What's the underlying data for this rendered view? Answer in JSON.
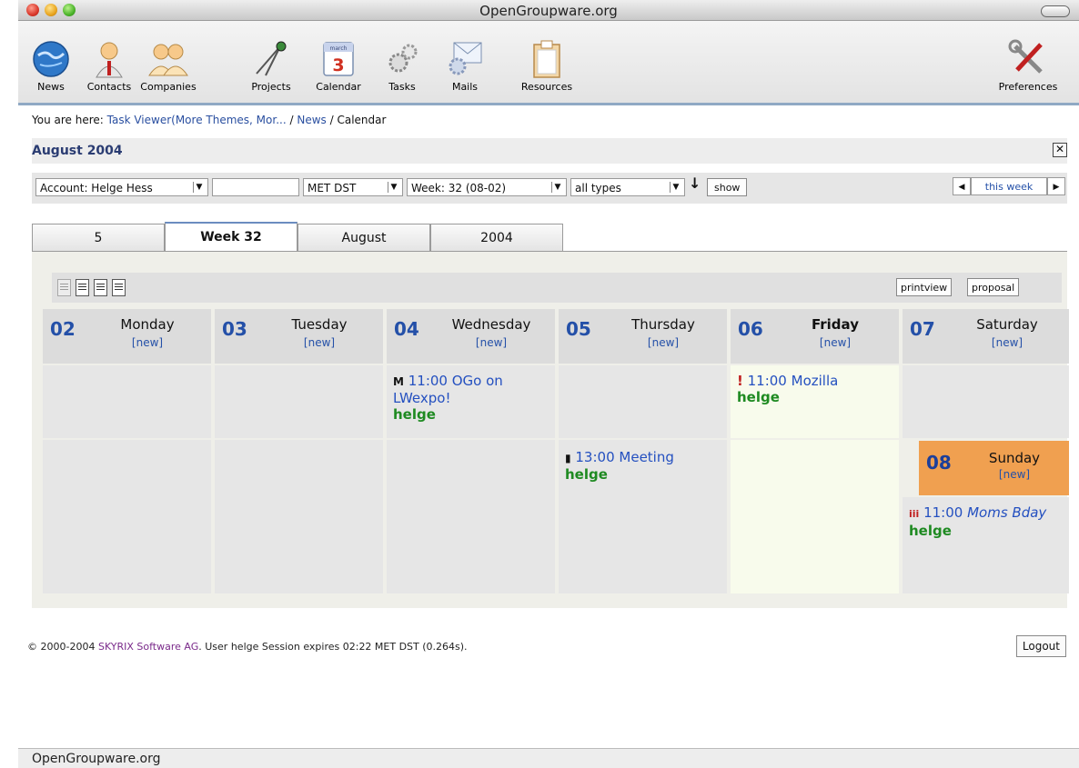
{
  "window": {
    "title": "OpenGroupware.org"
  },
  "toolbar": {
    "items": [
      {
        "label": "News",
        "icon": "globe-icon"
      },
      {
        "label": "Contacts",
        "icon": "person-icon"
      },
      {
        "label": "Companies",
        "icon": "people-group-icon"
      },
      {
        "label": "Projects",
        "icon": "compass-icon"
      },
      {
        "label": "Calendar",
        "icon": "calendar-icon",
        "badge_text": "march",
        "badge_num": "3"
      },
      {
        "label": "Tasks",
        "icon": "gears-icon"
      },
      {
        "label": "Mails",
        "icon": "envelope-icon"
      },
      {
        "label": "Resources",
        "icon": "clipboard-icon"
      }
    ],
    "preferences": {
      "label": "Preferences",
      "icon": "wrench-screwdriver-icon"
    }
  },
  "breadcrumb": {
    "prefix": "You are here:",
    "link1": "Task Viewer(More Themes, Mor...",
    "sep1": "/",
    "link2": "News",
    "sep2": "/",
    "current": "Calendar"
  },
  "panel": {
    "title": "August 2004",
    "close": "✕"
  },
  "filters": {
    "account": "Account: Helge Hess",
    "search": "",
    "timezone": "MET DST",
    "week": "Week: 32 (08-02)",
    "types": "all types",
    "show_button": "show",
    "this_week": "this week",
    "prev": "◀",
    "next": "▶"
  },
  "tabs": [
    {
      "label": "5",
      "active": false
    },
    {
      "label": "Week 32",
      "active": true
    },
    {
      "label": "August",
      "active": false
    },
    {
      "label": "2004",
      "active": false
    }
  ],
  "calendar_actions": {
    "printview": "printview",
    "proposal": "proposal"
  },
  "days": [
    {
      "num": "02",
      "name": "Monday",
      "new": "[new]"
    },
    {
      "num": "03",
      "name": "Tuesday",
      "new": "[new]"
    },
    {
      "num": "04",
      "name": "Wednesday",
      "new": "[new]"
    },
    {
      "num": "05",
      "name": "Thursday",
      "new": "[new]"
    },
    {
      "num": "06",
      "name": "Friday",
      "new": "[new]"
    },
    {
      "num": "07",
      "name": "Saturday",
      "new": "[new]"
    }
  ],
  "sunday": {
    "num": "08",
    "name": "Sunday",
    "new": "[new]"
  },
  "events": {
    "wed": {
      "icon": "M",
      "time": "11:00",
      "title": "OGo on LWexpo!",
      "user": "helge"
    },
    "fri": {
      "icon": "!",
      "time": "11:00",
      "title": "Mozilla",
      "user": "helge"
    },
    "thu": {
      "icon": "▮",
      "time": "13:00",
      "title": "Meeting",
      "user": "helge"
    },
    "sun": {
      "icon": "iii",
      "time": "11:00",
      "title": "Moms Bday",
      "user": "helge"
    }
  },
  "footer": {
    "copyright": "© 2000-2004",
    "brand": "SKYRIX Software AG",
    "rest": ". User helge Session expires 02:22 MET DST (0.264s).",
    "logout": "Logout"
  },
  "statusbar": {
    "text": "OpenGroupware.org"
  },
  "colors": {
    "accent": "#2450a8",
    "user": "#1e8a21",
    "sunday": "#f0a050",
    "friday": "#f8fbec"
  }
}
